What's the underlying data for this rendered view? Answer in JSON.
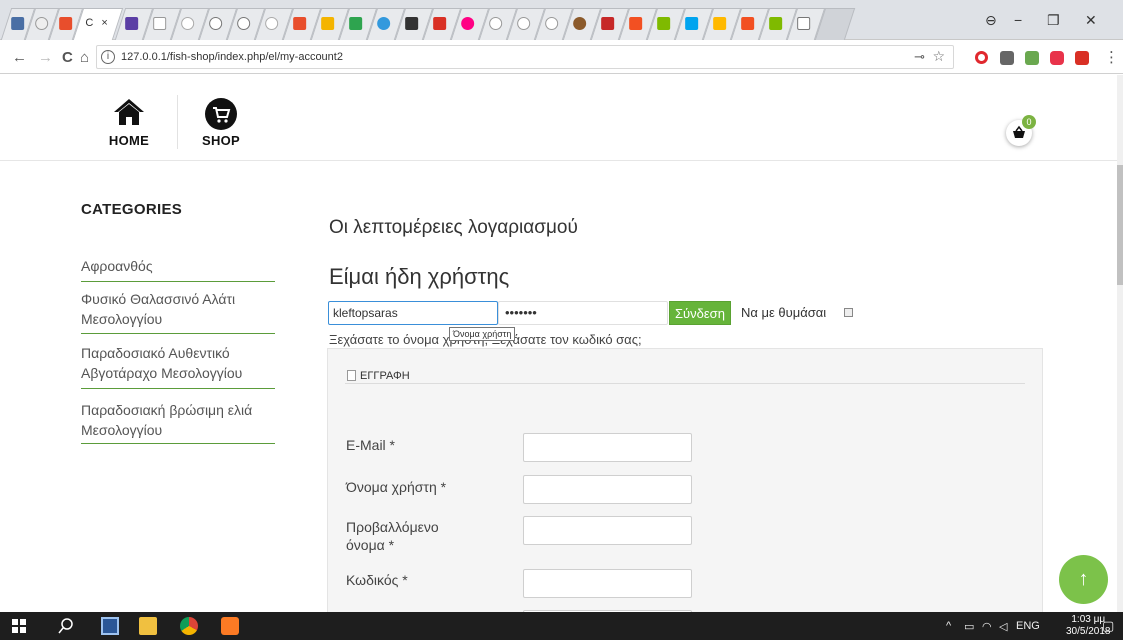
{
  "browser": {
    "url": "127.0.0.1/fish-shop/index.php/el/my-account2",
    "active_tab_label": "C",
    "info_label": "i",
    "back_icon": "←",
    "forward_icon": "→",
    "reload_icon": "C",
    "home_icon": "⌂",
    "key_icon": "⊸",
    "star_icon": "☆",
    "minimize_icon": "−",
    "maximize_icon": "❐",
    "close_icon": "✕",
    "profile_icon": "⊖",
    "menu_icon": "⋮"
  },
  "site_nav": {
    "home_label": "HOME",
    "shop_label": "SHOP",
    "cart_count": "0"
  },
  "sidebar": {
    "title": "CATEGORIES",
    "items": [
      {
        "label": "Αφροανθός"
      },
      {
        "label": "Φυσικό Θαλασσινό Αλάτι Μεσολογγίου"
      },
      {
        "label": "Παραδοσιακό Αυθεντικό Αβγοτάραχο Μεσολογγίου"
      },
      {
        "label": "Παραδοσιακή βρώσιμη ελιά Μεσολογγίου"
      }
    ]
  },
  "account": {
    "title": "Οι λεπτομέρειες λογαριασμού",
    "login_title": "Είμαι ήδη χρήστης",
    "username_value": "kleftopsaras",
    "password_value": "•••••••",
    "login_button": "Σύνδεση",
    "remember_label": "Να με θυμάσαι",
    "forgot_text": "Ξεχάσατε το όνομα χρήστη; Ξεχάσατε τον κωδικό σας;",
    "tooltip": "Όνομα χρήστη"
  },
  "register": {
    "tab_label": "ΕΓΓΡΑΦΗ",
    "fields": [
      {
        "label": "E-Mail *"
      },
      {
        "label": "Όνομα χρήστη *"
      },
      {
        "label": "Προβαλλόμενο όνομα *"
      },
      {
        "label": "Κωδικός *"
      }
    ]
  },
  "back_to_top_icon": "↑",
  "taskbar": {
    "language": "ENG",
    "time": "1:03 μμ",
    "date": "30/5/2018"
  },
  "colors": {
    "accent_green": "#66b43a",
    "sidebar_rule": "#5b9c3a",
    "focus_blue": "#3a8fd9"
  }
}
